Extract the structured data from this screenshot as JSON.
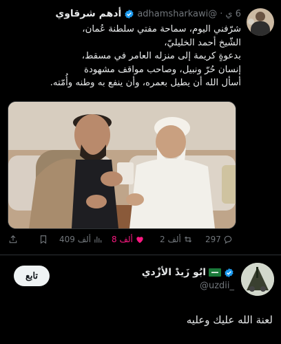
{
  "tweet": {
    "author_name": "أدهم شرقاوي",
    "handle": "@adhamsharkawi",
    "time": "6 ي",
    "lines": [
      "شرّفني اليوم، سماحة مفتي سلطنة عُمان،",
      "الشّيخ أحمد الخليليّ،",
      "بدعوةٍ كريمة إلى منزله العامر في مسقط،",
      "إنسان حُرّ ونبيل، وصاحب مواقف مشهودة",
      "أسأل الله أن يطيل بعمره، وأن ينفع به وطنه وأُمّته."
    ],
    "actions": {
      "replies": "297",
      "reposts": "2 ألف",
      "likes": "8 ألف",
      "views": "409 ألف"
    }
  },
  "reply": {
    "author_name": "ابُو زَيدْ الأزْدي",
    "handle": "@uzdii_",
    "follow_label": "تابع",
    "text": "لعنة الله عليك وعليه"
  },
  "colors": {
    "background": "#000000",
    "text": "#e7e9ea",
    "muted": "#71767b",
    "verified": "#1d9bf0",
    "like": "#f91880"
  }
}
